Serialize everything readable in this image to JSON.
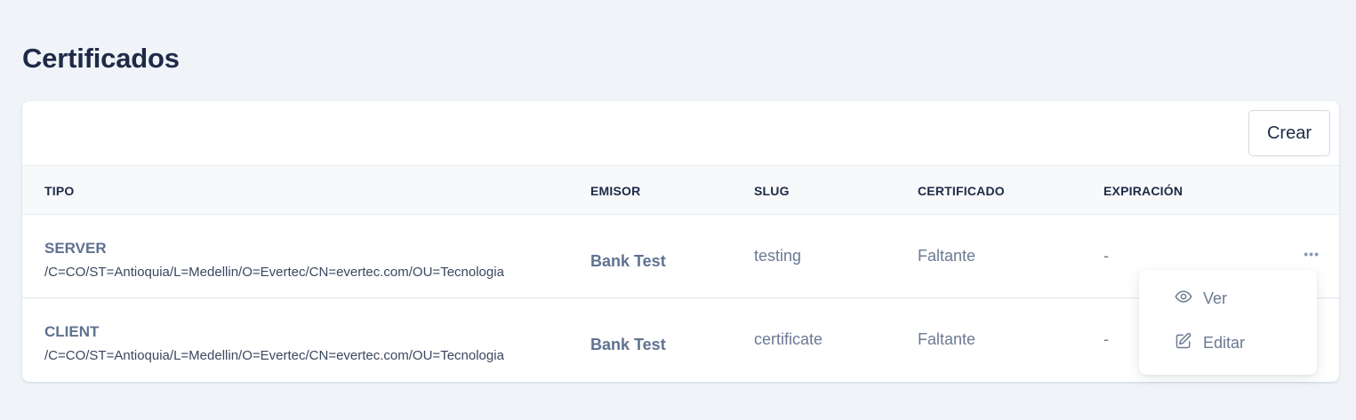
{
  "page": {
    "title": "Certificados"
  },
  "toolbar": {
    "create_label": "Crear"
  },
  "table": {
    "columns": [
      "TIPO",
      "EMISOR",
      "SLUG",
      "CERTIFICADO",
      "EXPIRACIÓN"
    ],
    "rows": [
      {
        "type": "SERVER",
        "dn": "/C=CO/ST=Antioquia/L=Medellin/O=Evertec/CN=evertec.com/OU=Tecnologia",
        "emisor": "Bank Test",
        "slug": "testing",
        "certificado": "Faltante",
        "expiracion": "-",
        "actions_icon": "ellipsis-icon"
      },
      {
        "type": "CLIENT",
        "dn": "/C=CO/ST=Antioquia/L=Medellin/O=Evertec/CN=evertec.com/OU=Tecnologia",
        "emisor": "Bank Test",
        "slug": "certificate",
        "certificado": "Faltante",
        "expiracion": "-"
      }
    ]
  },
  "actions_menu": {
    "items": [
      {
        "label": "Ver",
        "icon": "eye-icon"
      },
      {
        "label": "Editar",
        "icon": "edit-icon"
      }
    ]
  },
  "colors": {
    "background": "#f0f4f8",
    "title": "#1e2a47",
    "muted_text": "#6b7a93",
    "header_bg": "#f7f9fb"
  }
}
